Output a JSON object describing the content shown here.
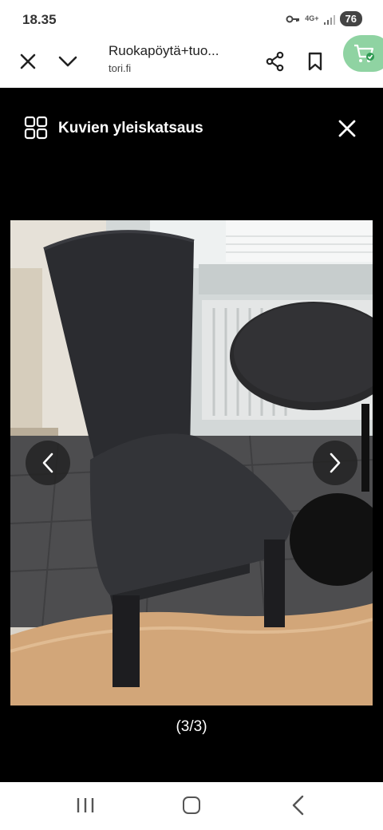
{
  "status_bar": {
    "time": "18.35",
    "network": "4G+",
    "battery": "76",
    "icons": [
      "key-icon",
      "signal-icon"
    ]
  },
  "browser_bar": {
    "title": "Ruokapöytä+tuo...",
    "url": "tori.fi",
    "icons": [
      "close-icon",
      "chevron-down-icon",
      "share-icon",
      "bookmark-icon",
      "cart-icon"
    ],
    "accent_color": "#8fd3a2"
  },
  "gallery": {
    "title": "Kuvien yleiskatsaus",
    "counter": "(3/3)",
    "icons": [
      "grid-icon",
      "close-icon",
      "chevron-left-icon",
      "chevron-right-icon"
    ]
  },
  "android_nav": {
    "icons": [
      "recent-apps-icon",
      "home-icon",
      "back-icon"
    ]
  }
}
